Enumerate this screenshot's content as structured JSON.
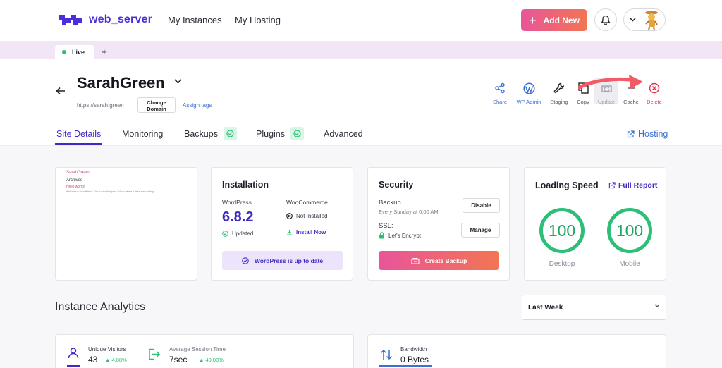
{
  "header": {
    "logo_text": "web_server",
    "nav": [
      "My Instances",
      "My Hosting"
    ],
    "add_new_label": "Add New",
    "accent": "#4b2ddb",
    "gradient": [
      "#e8559a",
      "#f27552"
    ]
  },
  "tabs": {
    "live_label": "Live",
    "add_tab": "+"
  },
  "site": {
    "title": "SarahGreen",
    "url": "https://sarah.green",
    "change_domain": "Change Domain",
    "assign_tags": "Assign tags"
  },
  "actions": [
    {
      "label": "Share",
      "icon": "share-icon"
    },
    {
      "label": "WP Admin",
      "icon": "wordpress-icon"
    },
    {
      "label": "Staging",
      "icon": "staging-icon"
    },
    {
      "label": "Copy",
      "icon": "copy-icon"
    },
    {
      "label": "Update",
      "icon": "update-icon"
    },
    {
      "label": "Cache",
      "icon": "cache-icon"
    },
    {
      "label": "Delete",
      "icon": "delete-icon"
    }
  ],
  "main_tabs": {
    "site_details": "Site Details",
    "monitoring": "Monitoring",
    "backups": "Backups",
    "plugins": "Plugins",
    "advanced": "Advanced",
    "hosting": "Hosting"
  },
  "preview": {
    "site_name": "SarahGreen",
    "archives": "Archives",
    "hello": "Hello world!",
    "body": "Welcome to WordPress. This is your first post. Edit or delete it, then start writing!"
  },
  "installation": {
    "title": "Installation",
    "wp_label": "WordPress",
    "wp_version": "6.8.2",
    "wp_status": "Updated",
    "woo_label": "WooCommerce",
    "woo_status": "Not Installed",
    "install_now": "Install Now",
    "uptodate": "WordPress is up to date"
  },
  "security": {
    "title": "Security",
    "backup_label": "Backup",
    "backup_schedule": "Every Sunday at 0:00 AM.",
    "disable": "Disable",
    "ssl_label": "SSL:",
    "ssl_provider": "Let's Encrypt",
    "manage": "Manage",
    "create_backup": "Create Backup"
  },
  "speed": {
    "title": "Loading Speed",
    "full_report": "Full Report",
    "desktop_score": "100",
    "desktop_label": "Desktop",
    "mobile_score": "100",
    "mobile_label": "Mobile"
  },
  "analytics": {
    "title": "Instance Analytics",
    "range": "Last Week",
    "unique_visitors_label": "Unique Visitors",
    "unique_visitors": "43",
    "unique_visitors_delta": "▲ 4.88%",
    "session_label": "Average Session Time",
    "session": "7sec",
    "session_delta": "▲ 40.00%",
    "bandwidth_label": "Bandwidth",
    "bandwidth": "0 Bytes"
  }
}
